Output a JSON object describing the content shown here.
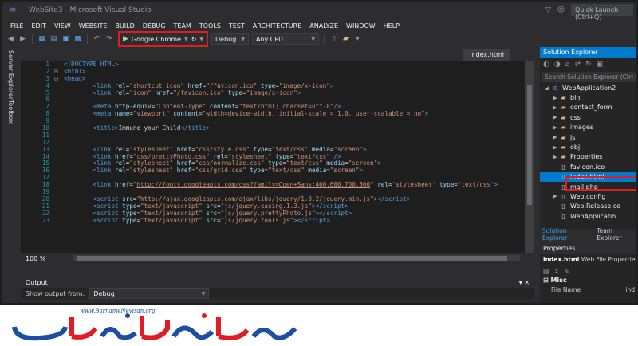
{
  "window": {
    "title": "WebSite3 - Microsoft Visual Studio",
    "quick_launch_placeholder": "Quick Launch (Ctrl+Q)"
  },
  "menu": [
    "FILE",
    "EDIT",
    "VIEW",
    "WEBSITE",
    "BUILD",
    "DEBUG",
    "TEAM",
    "TOOLS",
    "TEST",
    "ARCHITECTURE",
    "ANALYZE",
    "WINDOW",
    "HELP"
  ],
  "toolbar": {
    "run_target": "Google Chrome",
    "configuration": "Debug",
    "platform": "Any CPU",
    "highlight_color": "#e31b23"
  },
  "side_tabs": [
    "Server Explorer",
    "Toolbox"
  ],
  "editor": {
    "tab_label": "index.html",
    "zoom": "100 %",
    "lines": [
      {
        "n": "1",
        "fold": "",
        "html": "<span class='t-tag'>&lt;!DOCTYPE HTML&gt;</span>"
      },
      {
        "n": "2",
        "fold": "⊟",
        "html": "<span class='t-tag'>&lt;html&gt;</span>"
      },
      {
        "n": "3",
        "fold": "⊟",
        "html": "<span class='t-tag'>&lt;head&gt;</span>"
      },
      {
        "n": "4",
        "fold": "",
        "html": "        <span class='t-tag'>&lt;link</span> <span class='t-attr'>rel</span>=<span class='t-val'>\"shortcut icon\"</span> <span class='t-attr'>href</span>=<span class='t-val'>\"/favicon.ico\"</span> <span class='t-attr'>type</span>=<span class='t-val'>\"image/x-icon\"</span><span class='t-tag'>&gt;</span>"
      },
      {
        "n": "5",
        "fold": "",
        "html": "        <span class='t-tag'>&lt;link</span> <span class='t-attr'>rel</span>=<span class='t-val'>\"icon\"</span> <span class='t-attr'>href</span>=<span class='t-val'>\"/favicon.ico\"</span> <span class='t-attr'>type</span>=<span class='t-val'>\"image/x-icon\"</span><span class='t-tag'>&gt;</span>"
      },
      {
        "n": "6",
        "fold": "",
        "html": ""
      },
      {
        "n": "7",
        "fold": "",
        "html": "        <span class='t-tag'>&lt;meta</span> <span class='t-attr'>http-equiv</span>=<span class='t-val'>\"Content-Type\"</span> <span class='t-attr'>content</span>=<span class='t-val'>\"text/html; charset=utf-8\"</span><span class='t-tag'>/&gt;</span>"
      },
      {
        "n": "8",
        "fold": "",
        "html": "        <span class='t-tag'>&lt;meta</span> <span class='t-attr'>name</span>=<span class='t-val'>\"viewport\"</span> <span class='t-attr'>content</span>=<span class='t-val'>\"width=device-width, initial-scale = 1.0, user-scalable = no\"</span><span class='t-tag'>&gt;</span>"
      },
      {
        "n": "9",
        "fold": "",
        "html": ""
      },
      {
        "n": "10",
        "fold": "",
        "html": "        <span class='t-tag'>&lt;title&gt;</span><span class='t-txt'>Immune your Child</span><span class='t-tag'>&lt;/title&gt;</span>"
      },
      {
        "n": "11",
        "fold": "",
        "html": ""
      },
      {
        "n": "12",
        "fold": "",
        "html": ""
      },
      {
        "n": "13",
        "fold": "",
        "html": "        <span class='t-tag'>&lt;link</span> <span class='t-attr'>rel</span>=<span class='t-val'>\"stylesheet\"</span> <span class='t-attr'>href</span>=<span class='t-val'>\"css/style.css\"</span> <span class='t-attr'>type</span>=<span class='t-val'>\"text/css\"</span> <span class='t-attr'>media</span>=<span class='t-val'>\"screen\"</span><span class='t-tag'>&gt;</span>"
      },
      {
        "n": "14",
        "fold": "",
        "html": "        <span class='t-tag'>&lt;link</span> <span class='t-attr'>href</span>=<span class='t-val'>\"css/prettyPhoto.css\"</span> <span class='t-attr'>rel</span>=<span class='t-val'>\"stylesheet\"</span> <span class='t-attr'>type</span>=<span class='t-val'>\"text/css\"</span> <span class='t-tag'>/&gt;</span>"
      },
      {
        "n": "15",
        "fold": "",
        "html": "        <span class='t-tag'>&lt;link</span> <span class='t-attr'>rel</span>=<span class='t-val'>\"stylesheet\"</span> <span class='t-attr'>href</span>=<span class='t-val'>\"css/normalize.css\"</span> <span class='t-attr'>type</span>=<span class='t-val'>\"text/css\"</span> <span class='t-attr'>media</span>=<span class='t-val'>\"screen\"</span><span class='t-tag'>&gt;</span>"
      },
      {
        "n": "16",
        "fold": "",
        "html": "        <span class='t-tag'>&lt;link</span> <span class='t-attr'>rel</span>=<span class='t-val'>\"stylesheet\"</span> <span class='t-attr'>href</span>=<span class='t-val'>\"css/grid.css\"</span> <span class='t-attr'>type</span>=<span class='t-val'>\"text/css\"</span> <span class='t-attr'>media</span>=<span class='t-val'>\"screen\"</span><span class='t-tag'>&gt;</span>"
      },
      {
        "n": "17",
        "fold": "",
        "html": ""
      },
      {
        "n": "18",
        "fold": "",
        "html": "        <span class='t-tag'>&lt;link</span> <span class='t-attr'>href</span>=<span class='t-val'>\"</span><span class='t-link'>http://fonts.googleapis.com/css?family=Open+Sans:400,600,700,800</span><span class='t-val'>\"</span> <span class='t-attr'>rel</span>=<span class='t-val'>'stylesheet'</span> <span class='t-attr'>type</span>=<span class='t-val'>'text/css'</span><span class='t-tag'>&gt;</span>"
      },
      {
        "n": "19",
        "fold": "",
        "html": ""
      },
      {
        "n": "20",
        "fold": "",
        "html": "        <span class='t-tag'>&lt;script</span> <span class='t-attr'>src</span>=<span class='t-val'>\"</span><span class='t-link'>http://ajax.googleapis.com/ajax/libs/jquery/1.8.2/jquery.min.js</span><span class='t-val'>\"</span><span class='t-tag'>&gt;&lt;/script&gt;</span>"
      },
      {
        "n": "21",
        "fold": "",
        "html": "        <span class='t-tag'>&lt;script</span> <span class='t-attr'>type</span>=<span class='t-val'>\"text/javascript\"</span> <span class='t-attr'>src</span>=<span class='t-val'>\"js/jquery.easing.1.3.js\"</span><span class='t-tag'>&gt;&lt;/script&gt;</span>"
      },
      {
        "n": "22",
        "fold": "",
        "html": "        <span class='t-tag'>&lt;script</span> <span class='t-attr'>type</span>=<span class='t-val'>\"text/javascript\"</span> <span class='t-attr'>src</span>=<span class='t-val'>\"js/jquery.prettyPhoto.js\"</span><span class='t-tag'>&gt;&lt;/script&gt;</span>"
      },
      {
        "n": "23",
        "fold": "",
        "html": "        <span class='t-tag'>&lt;script</span> <span class='t-attr'>type</span>=<span class='t-val'>\"text/javascript\"</span> <span class='t-attr'>src</span>=<span class='t-val'>\"js/jquery.tools.js\"</span><span class='t-tag'>&gt;&lt;/script&gt;</span>"
      }
    ]
  },
  "output": {
    "title": "Output",
    "show_from_label": "Show output from:",
    "show_from_value": "Debug"
  },
  "solution_explorer": {
    "title": "Solution Explorer",
    "search_placeholder": "Search Solution Explorer (Ctrl+;)",
    "items": [
      {
        "label": "WebApplication2",
        "kind": "proj",
        "depth": 0,
        "expander": "◢",
        "selected": false
      },
      {
        "label": "bin",
        "kind": "folder",
        "depth": 1,
        "expander": "▶",
        "selected": false
      },
      {
        "label": "contact_form",
        "kind": "folder",
        "depth": 1,
        "expander": "▶",
        "selected": false
      },
      {
        "label": "css",
        "kind": "folder",
        "depth": 1,
        "expander": "▶",
        "selected": false
      },
      {
        "label": "images",
        "kind": "folder",
        "depth": 1,
        "expander": "▶",
        "selected": false
      },
      {
        "label": "js",
        "kind": "folder",
        "depth": 1,
        "expander": "▶",
        "selected": false
      },
      {
        "label": "obj",
        "kind": "folder",
        "depth": 1,
        "expander": "▶",
        "selected": false
      },
      {
        "label": "Properties",
        "kind": "folder",
        "depth": 1,
        "expander": "▶",
        "selected": false
      },
      {
        "label": "favicon.ico",
        "kind": "file",
        "depth": 1,
        "expander": "",
        "selected": false
      },
      {
        "label": "index.html",
        "kind": "file",
        "depth": 1,
        "expander": "",
        "selected": true
      },
      {
        "label": "mail.php",
        "kind": "file",
        "depth": 1,
        "expander": "",
        "selected": false
      },
      {
        "label": "Web.config",
        "kind": "file",
        "depth": 1,
        "expander": "▶",
        "selected": false
      },
      {
        "label": "Web.Release.co",
        "kind": "file",
        "depth": 1,
        "expander": "",
        "selected": false
      },
      {
        "label": "WebApplicatio",
        "kind": "file",
        "depth": 1,
        "expander": "",
        "selected": false
      }
    ],
    "tabs": [
      "Solution Explorer",
      "Team Explorer"
    ]
  },
  "properties": {
    "title": "Properties",
    "object_name": "index.html",
    "object_type": "Web File Properties",
    "category": "Misc",
    "row_name": "File Name",
    "row_value": "ind"
  },
  "watermark": {
    "url": "www.BarnameNevisan.org",
    "logo_text": "برنامه نویسان"
  }
}
